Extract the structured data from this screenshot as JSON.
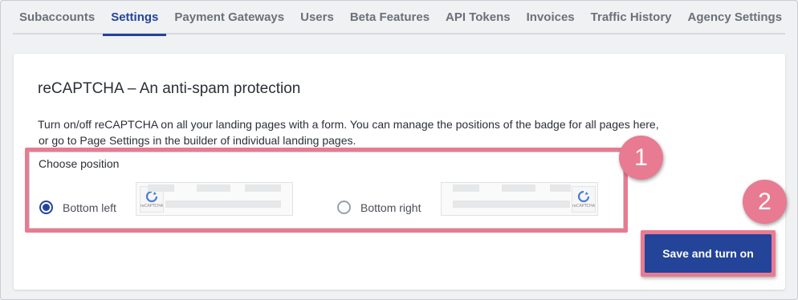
{
  "tabs": [
    {
      "label": "Subaccounts",
      "active": false
    },
    {
      "label": "Settings",
      "active": true
    },
    {
      "label": "Payment Gateways",
      "active": false
    },
    {
      "label": "Users",
      "active": false
    },
    {
      "label": "Beta Features",
      "active": false
    },
    {
      "label": "API Tokens",
      "active": false
    },
    {
      "label": "Invoices",
      "active": false
    },
    {
      "label": "Traffic History",
      "active": false
    },
    {
      "label": "Agency Settings",
      "active": false
    }
  ],
  "card": {
    "title": "reCAPTCHA – An anti-spam protection",
    "description_line1": "Turn on/off reCAPTCHA on all your landing pages with a form. You can manage the positions of the badge for all pages here,",
    "description_line2": "or go to Page Settings in the builder of individual landing pages."
  },
  "position": {
    "label": "Choose position",
    "options": [
      {
        "label": "Bottom left",
        "selected": true
      },
      {
        "label": "Bottom right",
        "selected": false
      }
    ],
    "badge_text": "reCAPTCHA"
  },
  "annotations": {
    "step1": "1",
    "step2": "2"
  },
  "save_button": {
    "label": "Save and turn on"
  },
  "colors": {
    "accent": "#24449a",
    "highlight": "#e87b91",
    "background": "#f0f1f3"
  }
}
